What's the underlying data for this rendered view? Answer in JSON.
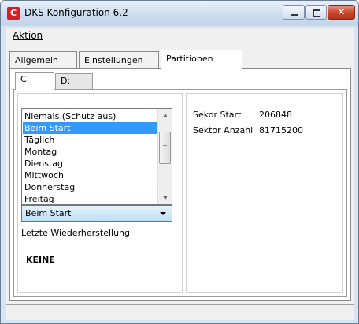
{
  "window": {
    "title": "DKS Konfiguration 6.2",
    "app_icon_letter": "C",
    "close_glyph": "✕"
  },
  "menu": {
    "items": [
      "Aktion"
    ]
  },
  "tabs": [
    "Allgemein",
    "Einstellungen",
    "Partitionen"
  ],
  "drive_tabs": [
    "C:",
    "D:"
  ],
  "schedule": {
    "options": [
      "Niemals (Schutz aus)",
      "Beim Start",
      "Täglich",
      "Montag",
      "Dienstag",
      "Mittwoch",
      "Donnerstag",
      "Freitag"
    ],
    "selected": "Beim Start",
    "restore_label": "Letzte Wiederherstellung",
    "restore_value": "KEINE"
  },
  "sector_info": {
    "start_label": "Sekor Start",
    "start_value": "206848",
    "count_label": "Sektor Anzahl",
    "count_value": "81715200"
  },
  "status_bar": {
    "text": ""
  }
}
